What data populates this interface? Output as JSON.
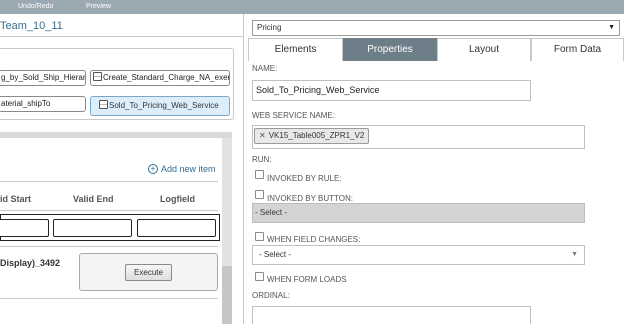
{
  "topbar": {
    "undo_redo": "Undo/Redo",
    "preview": "Preview"
  },
  "left": {
    "team_title": "Team_10_11",
    "nodes": [
      "g_by_Sold_Ship_Hierarch",
      "Create_Standard_Charge_NA_exempt",
      "aterial_shipTo",
      "Sold_To_Pricing_Web_Service"
    ],
    "add_new_item": "Add new item",
    "columns": [
      "id Start",
      "Valid End",
      "Logfield"
    ],
    "display_label": "Display)_3492",
    "execute_label": "Execute"
  },
  "right": {
    "dropdown_value": "Pricing",
    "tabs": [
      "Elements",
      "Properties",
      "Layout",
      "Form Data"
    ],
    "name_label": "NAME:",
    "name_value": "Sold_To_Pricing_Web_Service",
    "ws_label": "WEB SERVICE NAME:",
    "ws_tag": "VK15_Table005_ZPR1_V2",
    "run_label": "RUN:",
    "invoked_by_rule": "INVOKED BY RULE:",
    "invoked_by_button": "INVOKED BY BUTTON:",
    "button_select": "- Select -",
    "when_field_changes": "WHEN FIELD CHANGES:",
    "field_select": "- Select -",
    "when_form_loads": "WHEN FORM LOADS",
    "ordinal_label": "ORDINAL:"
  },
  "colors": {
    "active_tab": "#6e7e89",
    "link": "#2e6e99",
    "topbar": "#9aa9b2"
  }
}
